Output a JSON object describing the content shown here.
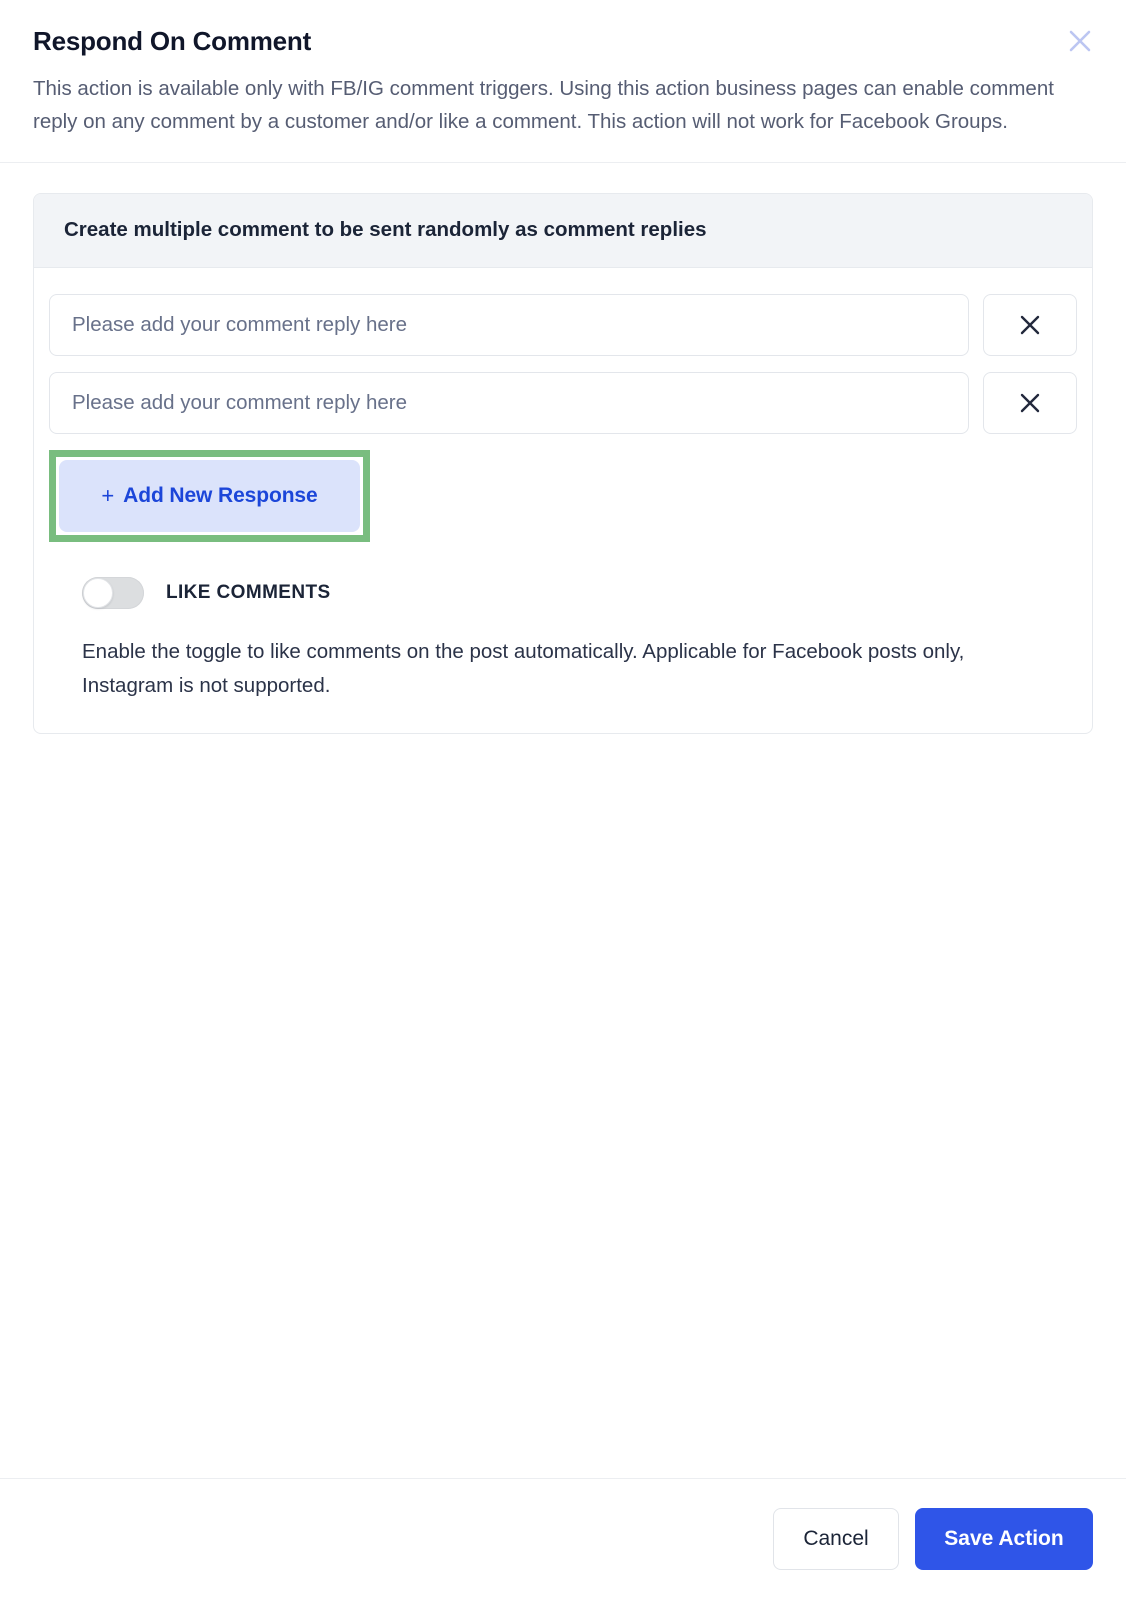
{
  "header": {
    "title": "Respond On Comment",
    "description": "This action is available only with FB/IG comment triggers. Using this action business pages can enable comment reply on any comment by a customer and/or like a comment. This action will not work for Facebook Groups.",
    "close_icon": "close-icon"
  },
  "card": {
    "heading": "Create multiple comment to be sent randomly as comment replies",
    "responses": [
      {
        "value": "",
        "placeholder": "Please add your comment reply here",
        "delete_icon": "close-icon"
      },
      {
        "value": "",
        "placeholder": "Please add your comment reply here",
        "delete_icon": "close-icon"
      }
    ],
    "add_button": {
      "plus": "+",
      "label": "Add New Response",
      "highlight_color": "#79bd7f",
      "background": "#dbe3fb",
      "text_color": "#1c46d9"
    },
    "toggle": {
      "label": "LIKE COMMENTS",
      "state": "off",
      "description": "Enable the toggle to like comments on the post automatically. Applicable for Facebook posts only, Instagram is not supported."
    }
  },
  "footer": {
    "cancel_label": "Cancel",
    "save_label": "Save Action",
    "save_color": "#2f55e8"
  }
}
